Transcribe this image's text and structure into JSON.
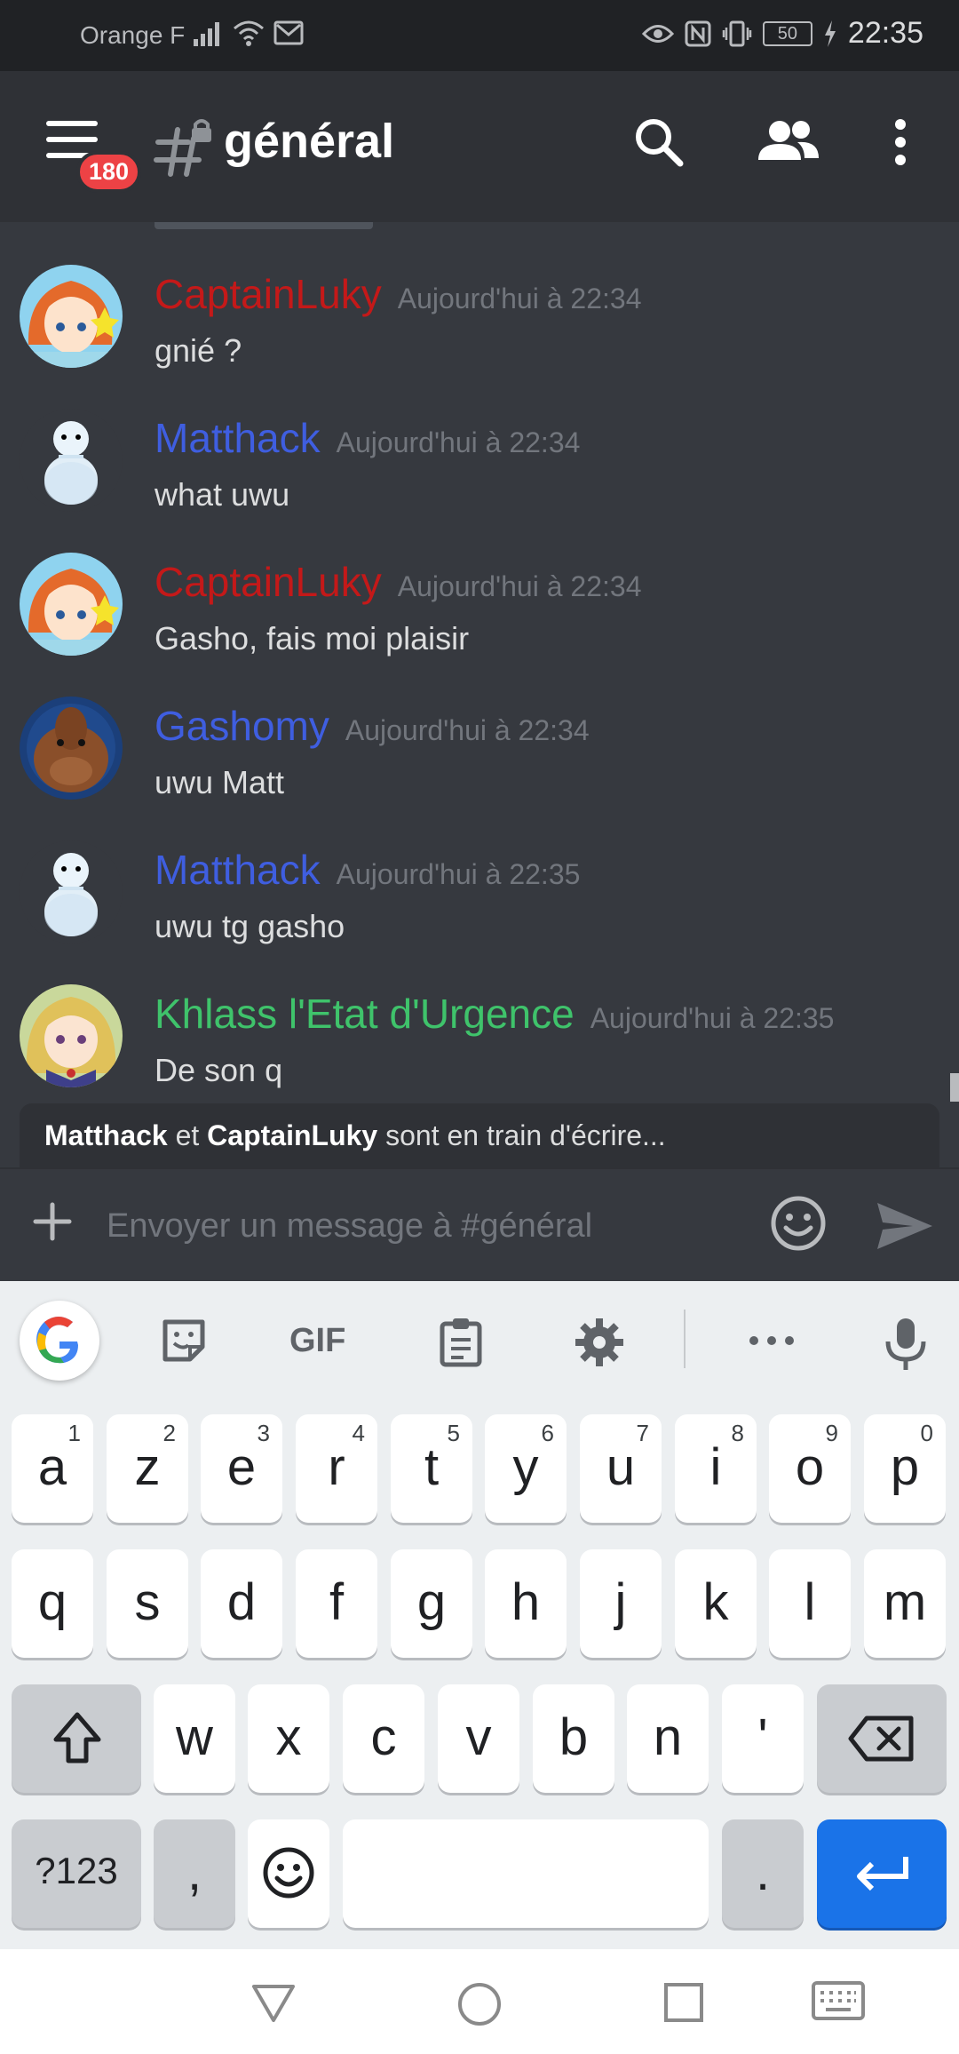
{
  "status_bar": {
    "carrier": "Orange F",
    "battery": "50",
    "time": "22:35"
  },
  "header": {
    "badge_count": "180",
    "channel_name": "général",
    "icons": [
      "menu-icon",
      "hashtag-lock-icon",
      "search-icon",
      "members-icon",
      "more-vertical-icon"
    ]
  },
  "messages": [
    {
      "author": "CaptainLuky",
      "author_color": "#c41919",
      "timestamp": "Aujourd'hui à 22:34",
      "text": "gnié ?",
      "avatar": "captainluky"
    },
    {
      "author": "Matthack",
      "author_color": "#3f5ee0",
      "timestamp": "Aujourd'hui à 22:34",
      "text": "what uwu",
      "avatar": "snowman"
    },
    {
      "author": "CaptainLuky",
      "author_color": "#c41919",
      "timestamp": "Aujourd'hui à 22:34",
      "text": "Gasho, fais moi plaisir",
      "avatar": "captainluky"
    },
    {
      "author": "Gashomy",
      "author_color": "#3f5ee0",
      "timestamp": "Aujourd'hui à 22:34",
      "text": "uwu Matt",
      "avatar": "walrus"
    },
    {
      "author": "Matthack",
      "author_color": "#3f5ee0",
      "timestamp": "Aujourd'hui à 22:35",
      "text": "uwu tg gasho",
      "avatar": "snowman"
    },
    {
      "author": "Khlass l'Etat d'Urgence",
      "author_color": "#3fc36b",
      "timestamp": "Aujourd'hui à 22:35",
      "text": "De son q",
      "avatar": "anime-blonde"
    }
  ],
  "typing": {
    "user1": "Matthack",
    "conj": "et",
    "user2": "CaptainLuky",
    "suffix": "sont en train d'écrire..."
  },
  "composer": {
    "placeholder": "Envoyer un message à #général",
    "value": ""
  },
  "keyboard": {
    "toolbar": {
      "gif_label": "GIF"
    },
    "rows": [
      [
        {
          "k": "a",
          "h": "1"
        },
        {
          "k": "z",
          "h": "2"
        },
        {
          "k": "e",
          "h": "3"
        },
        {
          "k": "r",
          "h": "4"
        },
        {
          "k": "t",
          "h": "5"
        },
        {
          "k": "y",
          "h": "6"
        },
        {
          "k": "u",
          "h": "7"
        },
        {
          "k": "i",
          "h": "8"
        },
        {
          "k": "o",
          "h": "9"
        },
        {
          "k": "p",
          "h": "0"
        }
      ],
      [
        {
          "k": "q"
        },
        {
          "k": "s"
        },
        {
          "k": "d"
        },
        {
          "k": "f"
        },
        {
          "k": "g"
        },
        {
          "k": "h"
        },
        {
          "k": "j"
        },
        {
          "k": "k"
        },
        {
          "k": "l"
        },
        {
          "k": "m"
        }
      ],
      [
        {
          "k": "w"
        },
        {
          "k": "x"
        },
        {
          "k": "c"
        },
        {
          "k": "v"
        },
        {
          "k": "b"
        },
        {
          "k": "n"
        },
        {
          "k": "'"
        }
      ]
    ],
    "symbols_label": "?123",
    "comma_label": ",",
    "period_label": "."
  },
  "colors": {
    "background": "#36393f",
    "header": "#2f3136",
    "badge": "#ed4245",
    "enter_key": "#1a73e8"
  }
}
